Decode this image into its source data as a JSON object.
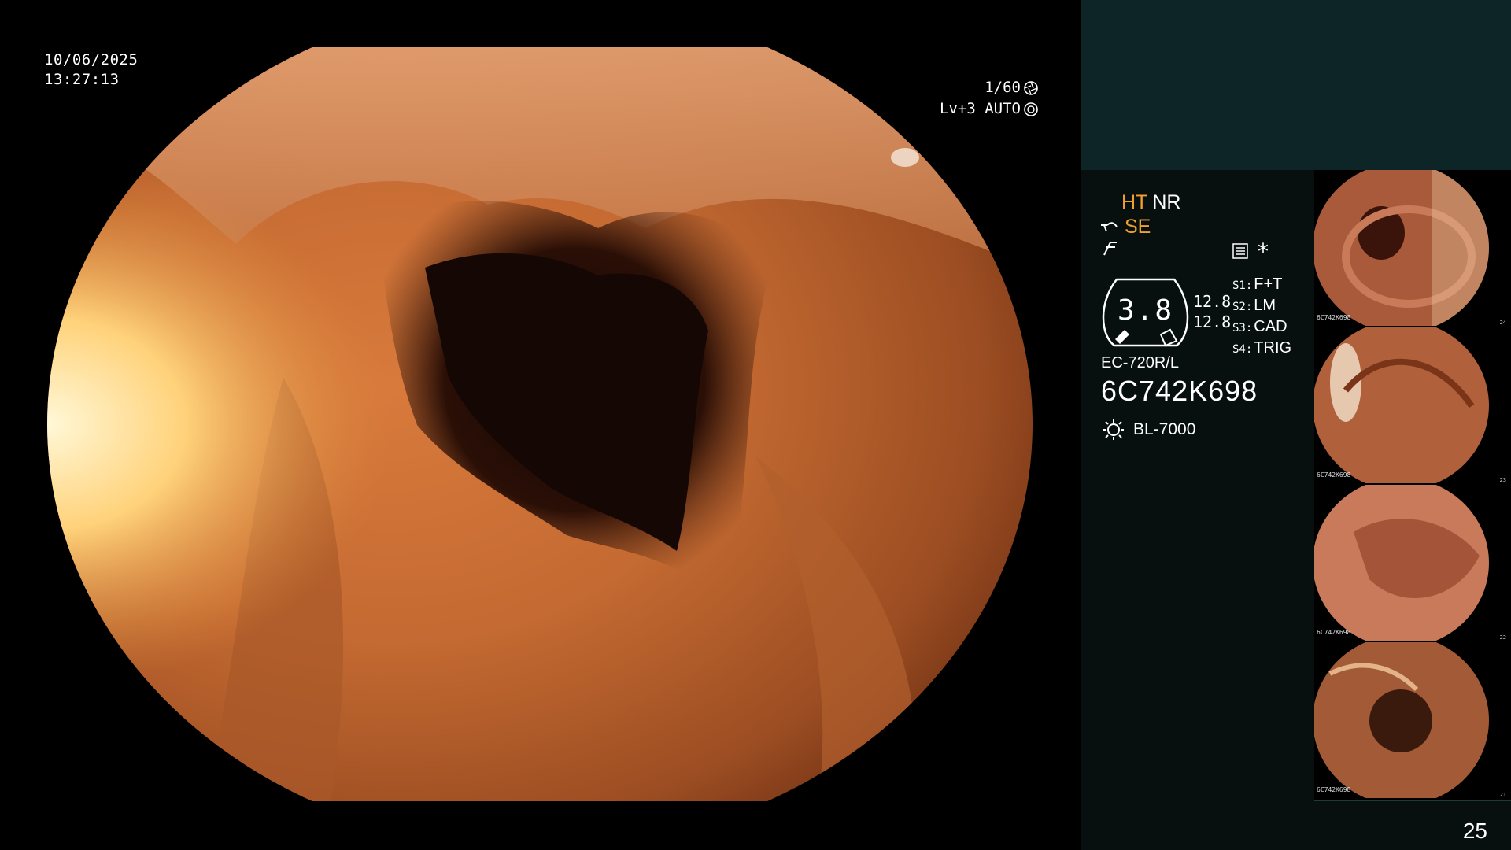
{
  "overlay": {
    "date": "10/06/2025",
    "time": "13:27:13",
    "shutter": "1/60",
    "level": "Lv+3 AUTO",
    "shutter_icon": "aperture-icon",
    "auto_icon": "iris-icon"
  },
  "panel": {
    "mode_ht": "HT",
    "mode_nr": "NR",
    "mode_se": "SE",
    "gauge_value": "3.8",
    "gauge_sub_1": "12.8",
    "gauge_sub_2": "12.8",
    "slots": [
      {
        "key": "S1:",
        "value": "F+T"
      },
      {
        "key": "S2:",
        "value": "LM"
      },
      {
        "key": "S3:",
        "value": "CAD"
      },
      {
        "key": "S4:",
        "value": "TRIG"
      }
    ],
    "scope_model": "EC-720R/L",
    "scope_serial": "6C742K698",
    "light_source": "BL-7000",
    "star": "*"
  },
  "thumbnails": [
    {
      "tag": "6C742K698",
      "num": "24"
    },
    {
      "tag": "6C742K698",
      "num": "23"
    },
    {
      "tag": "6C742K698",
      "num": "22"
    },
    {
      "tag": "6C742K698",
      "num": "21"
    }
  ],
  "page_number": "25",
  "colors": {
    "accent": "#f2a12e",
    "panel_top": "#0e2528",
    "panel_bg": "#07100f"
  }
}
